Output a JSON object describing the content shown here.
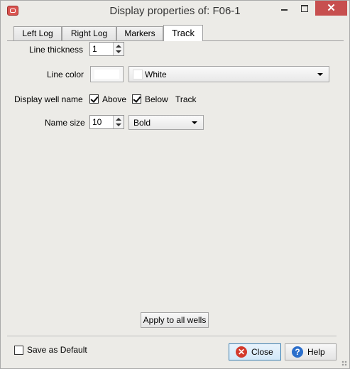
{
  "window": {
    "title": "Display properties of: F06-1",
    "close_glyph": "✕"
  },
  "tabs": [
    {
      "label": "Left Log"
    },
    {
      "label": "Right Log"
    },
    {
      "label": "Markers"
    },
    {
      "label": "Track",
      "active": true
    }
  ],
  "track": {
    "line_thickness_label": "Line thickness",
    "line_thickness_value": "1",
    "line_color_label": "Line color",
    "line_color_value": "White",
    "display_well_name_label": "Display well name",
    "above_label": "Above",
    "above_checked": true,
    "below_label": "Below",
    "below_checked": true,
    "track_label": "Track",
    "name_size_label": "Name size",
    "name_size_value": "10",
    "font_style_value": "Bold",
    "apply_all_label": "Apply to all wells"
  },
  "footer": {
    "save_default_label": "Save as Default",
    "save_default_checked": false,
    "close_label": "Close",
    "help_label": "Help"
  },
  "colors": {
    "window_bg": "#ecebe7",
    "close_button_bg": "#c74f4f",
    "line_color_swatch": "#ffffff"
  },
  "icons": [
    "app-icon",
    "minimize-icon",
    "maximize-icon",
    "close-icon",
    "help-icon",
    "spinner-up-icon",
    "spinner-down-icon",
    "chevron-down-icon"
  ]
}
